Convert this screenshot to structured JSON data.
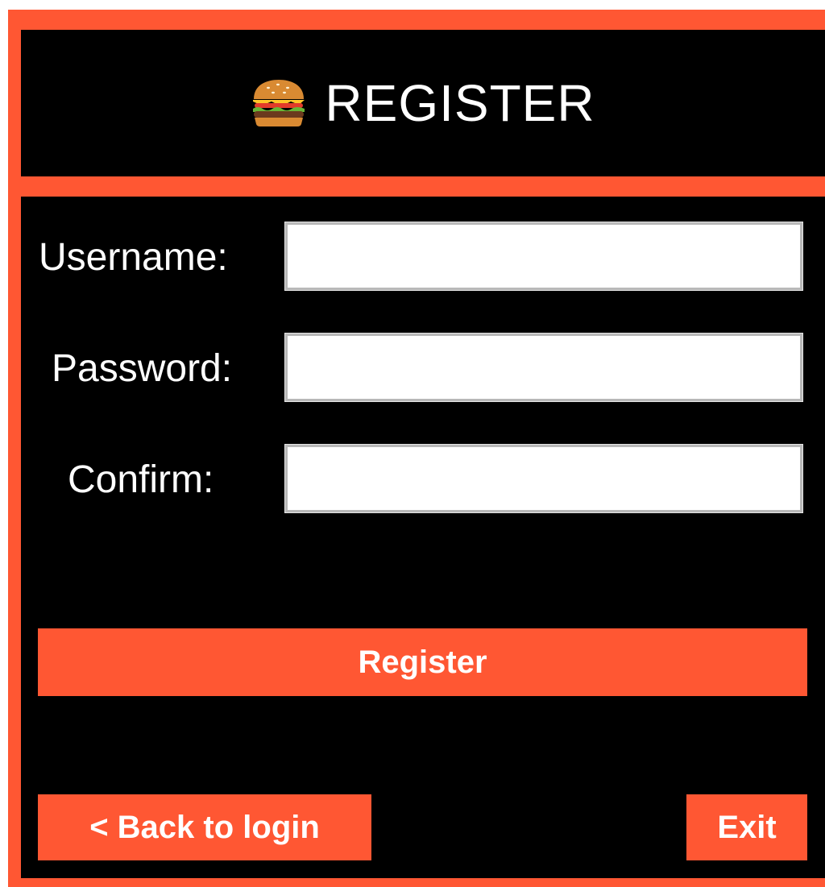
{
  "header": {
    "icon": "burger-icon",
    "title": "REGISTER"
  },
  "form": {
    "username_label": "Username:",
    "username_value": "",
    "password_label": "Password:",
    "password_value": "",
    "confirm_label": "Confirm:",
    "confirm_value": ""
  },
  "actions": {
    "register_label": "Register",
    "back_label": "< Back to login",
    "exit_label": "Exit"
  },
  "colors": {
    "accent": "#ff5733",
    "background": "#000000",
    "text": "#ffffff"
  }
}
